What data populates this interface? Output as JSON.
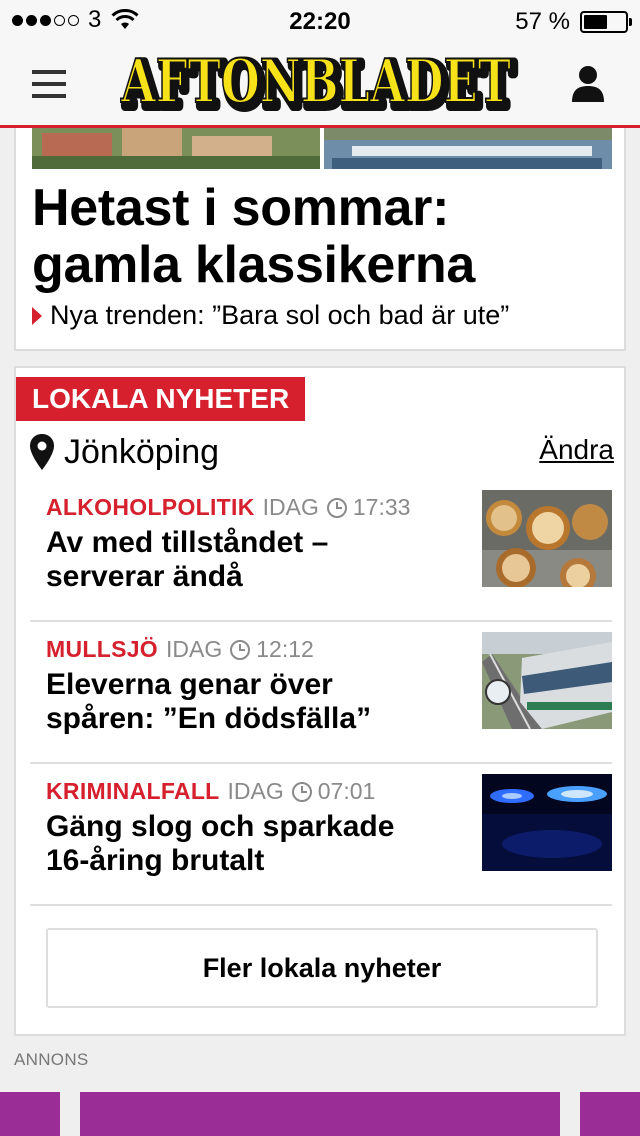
{
  "status_bar": {
    "carrier": "3",
    "time": "22:20",
    "battery": "57 %",
    "battery_level": 0.57
  },
  "header": {
    "logo_text": "AFTONBLADET",
    "menu_icon": "hamburger-icon",
    "user_icon": "user-icon"
  },
  "top_story": {
    "headline": "Hetast i sommar: gamla klassikerna",
    "subline": "Nya trenden: ”Bara sol och bad är ute”"
  },
  "local_news": {
    "section_label": "LOKALA NYHETER",
    "location": "Jönköping",
    "change_label": "Ändra",
    "items": [
      {
        "category": "ALKOHOLPOLITIK",
        "day": "IDAG",
        "time": "17:33",
        "title": "Av med tillståndet – serverar ändå"
      },
      {
        "category": "MULLSJÖ",
        "day": "IDAG",
        "time": "12:12",
        "title": "Eleverna genar över spåren: ”En dödsfälla”"
      },
      {
        "category": "KRIMINALFALL",
        "day": "IDAG",
        "time": "07:01",
        "title": "Gäng slog och sparkade 16-åring brutalt"
      }
    ],
    "more_label": "Fler lokala nyheter"
  },
  "ad": {
    "label": "ANNONS",
    "color": "#9b2d96"
  },
  "colors": {
    "accent": "#d6202d",
    "logo_yellow": "#f7e21a"
  }
}
